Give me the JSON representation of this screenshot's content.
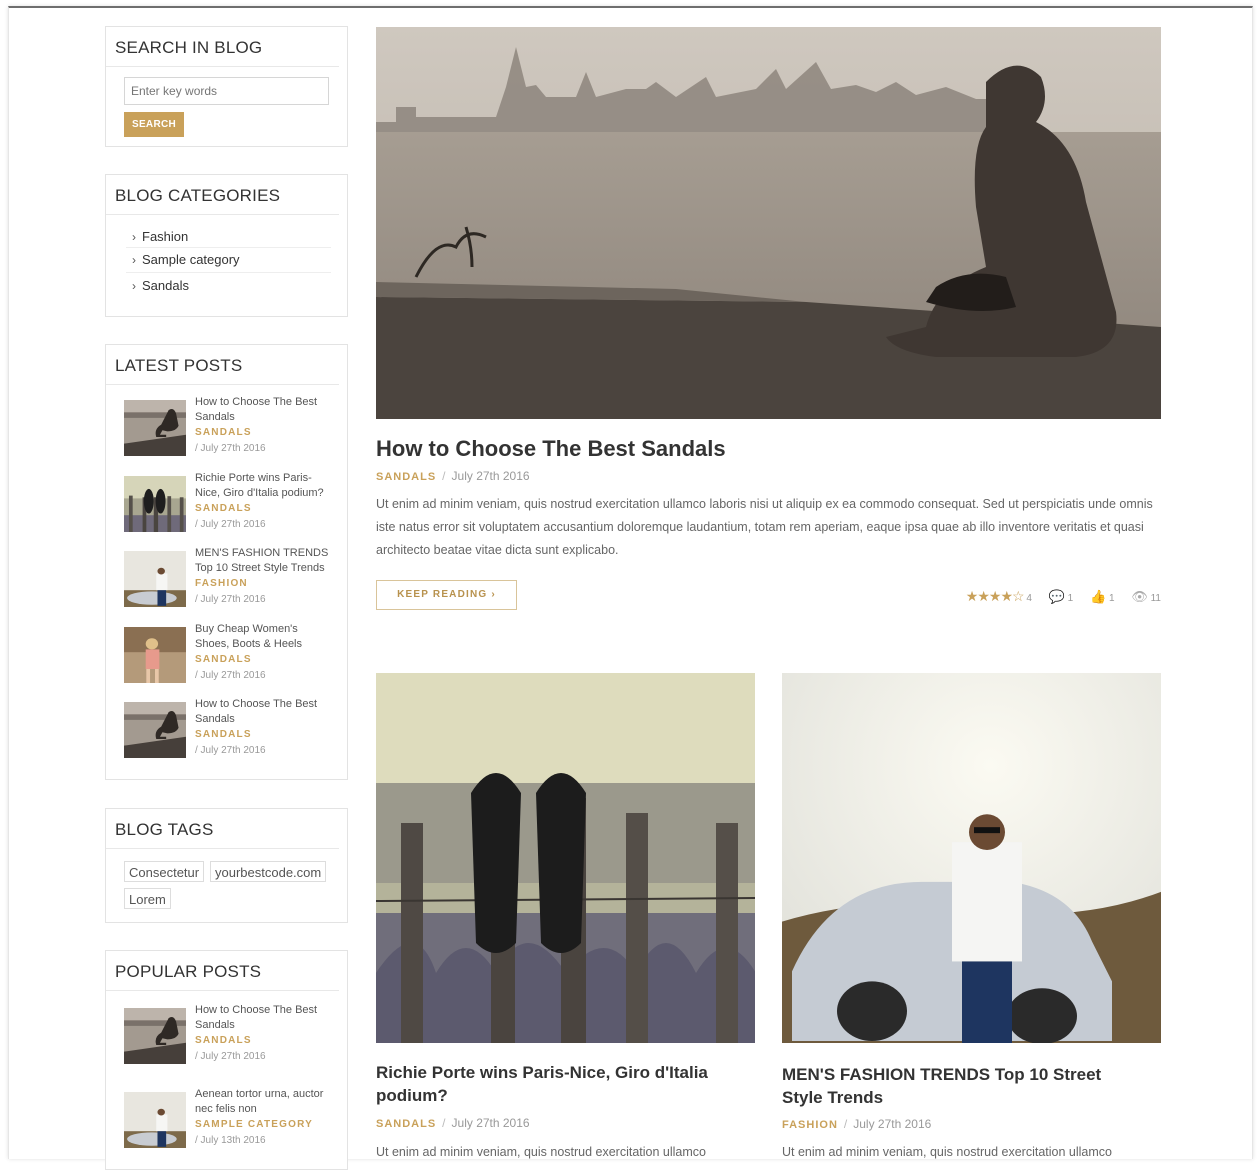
{
  "search": {
    "title": "SEARCH IN BLOG",
    "placeholder": "Enter key words",
    "button": "SEARCH"
  },
  "categories": {
    "title": "BLOG CATEGORIES",
    "items": [
      "Fashion",
      "Sample category",
      "Sandals"
    ]
  },
  "latest": {
    "title": "LATEST POSTS",
    "items": [
      {
        "title": "How to Choose The Best Sandals",
        "category": "SANDALS",
        "date": "/  July 27th 2016"
      },
      {
        "title": "Richie Porte wins Paris-Nice, Giro d'Italia podium?",
        "category": "SANDALS",
        "date": "/  July 27th 2016"
      },
      {
        "title": "MEN'S FASHION TRENDS Top 10 Street Style Trends",
        "category": "FASHION",
        "date": "/  July 27th 2016"
      },
      {
        "title": "Buy Cheap Women's Shoes, Boots & Heels",
        "category": "SANDALS",
        "date": "/  July 27th 2016"
      },
      {
        "title": "How to Choose The Best Sandals",
        "category": "SANDALS",
        "date": "/  July 27th 2016"
      }
    ]
  },
  "tags": {
    "title": "BLOG TAGS",
    "items": [
      "Consectetur",
      "yourbestcode.com",
      "Lorem"
    ]
  },
  "popular": {
    "title": "POPULAR POSTS",
    "items": [
      {
        "title": "How to Choose The Best Sandals",
        "category": "SANDALS",
        "date": "/  July 27th 2016"
      },
      {
        "title": "Aenean tortor urna, auctor nec felis non",
        "category": "SAMPLE CATEGORY",
        "date": "/  July 13th 2016"
      }
    ]
  },
  "featured": {
    "title": "How to Choose The Best Sandals",
    "category": "SANDALS",
    "sep": "/",
    "date": "July 27th 2016",
    "excerpt": "Ut enim ad minim veniam, quis nostrud exercitation ullamco laboris nisi ut aliquip ex ea commodo consequat. Sed ut perspiciatis unde omnis iste natus error sit voluptatem accusantium doloremque laudantium, totam rem aperiam, eaque ipsa quae ab illo inventore veritatis et quasi architecto beatae vitae dicta sunt explicabo.",
    "keep_reading": "KEEP READING  ›",
    "stars": "★★★★☆",
    "rating": "4",
    "comments": "1",
    "likes": "1",
    "views": "11"
  },
  "cards": [
    {
      "title": "Richie Porte wins Paris-Nice, Giro d'Italia podium?",
      "category": "SANDALS",
      "sep": "/",
      "date": "July 27th 2016",
      "excerpt": "Ut enim ad minim veniam, quis nostrud exercitation ullamco"
    },
    {
      "title": "MEN'S FASHION TRENDS Top 10 Street Style Trends",
      "category": "FASHION",
      "sep": "/",
      "date": "July 27th 2016",
      "excerpt": "Ut enim ad minim veniam, quis nostrud exercitation ullamco"
    }
  ],
  "colors": {
    "accent": "#c9a15a",
    "text": "#333333",
    "muted": "#999999"
  }
}
